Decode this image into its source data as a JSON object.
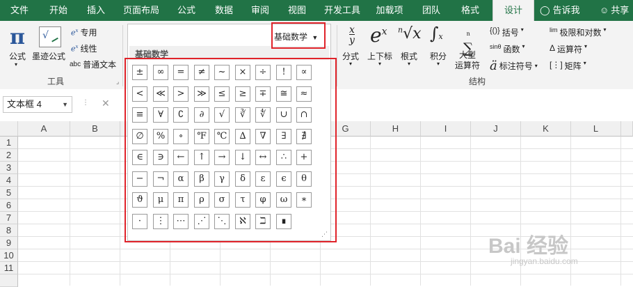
{
  "ribbon_tabs": [
    "文件",
    "开始",
    "插入",
    "页面布局",
    "公式",
    "数据",
    "审阅",
    "视图",
    "开发工具",
    "加载项",
    "团队",
    "格式",
    "设计"
  ],
  "tell_me": "告诉我",
  "share": "共享",
  "tools_group": {
    "equation_label": "公式",
    "ink_equation_label": "墨迹公式",
    "professional": "专用",
    "linear": "线性",
    "normal_text": "普通文本",
    "normal_text_prefix": "abc",
    "label": "工具"
  },
  "structures_group": {
    "fraction": "分式",
    "script": "上下标",
    "radical": "根式",
    "integral": "积分",
    "large_operator": "大型\n运算符",
    "bracket": "括号",
    "function": "函数",
    "accent": "标注符号",
    "limit_log": "极限和对数",
    "operator": "运算符",
    "matrix": "矩阵",
    "label": "结构"
  },
  "name_box": "文本框 4",
  "formula_cancel": "✕",
  "columns": [
    "A",
    "B",
    "C",
    "D",
    "E",
    "F",
    "G",
    "H",
    "I",
    "J",
    "K",
    "L"
  ],
  "rows": [
    "1",
    "2",
    "3",
    "4",
    "5",
    "6",
    "7",
    "8",
    "9",
    "10",
    "11"
  ],
  "gallery": {
    "category_value": "基础数学",
    "header": "基础数学",
    "symbols": [
      [
        "±",
        "∞",
        "=",
        "≠",
        "~",
        "×",
        "÷",
        "!",
        "∝"
      ],
      [
        "<",
        "≪",
        ">",
        "≫",
        "≤",
        "≥",
        "∓",
        "≅",
        "≈"
      ],
      [
        "≡",
        "∀",
        "∁",
        "∂",
        "√",
        "∛",
        "∜",
        "∪",
        "∩"
      ],
      [
        "∅",
        "%",
        "∘",
        "℉",
        "℃",
        "∆",
        "∇",
        "∃",
        "∄"
      ],
      [
        "∈",
        "∋",
        "←",
        "↑",
        "→",
        "↓",
        "↔",
        "∴",
        "+"
      ],
      [
        "−",
        "¬",
        "α",
        "β",
        "γ",
        "δ",
        "ε",
        "ϵ",
        "θ"
      ],
      [
        "ϑ",
        "μ",
        "π",
        "ρ",
        "σ",
        "τ",
        "φ",
        "ω",
        "∗"
      ],
      [
        "·",
        "⋮",
        "⋯",
        "⋰",
        "⋱",
        "ℵ",
        "ℶ",
        "∎"
      ]
    ]
  },
  "watermark": {
    "logo": "Bai 经验",
    "url": "jingyan.baidu.com"
  }
}
